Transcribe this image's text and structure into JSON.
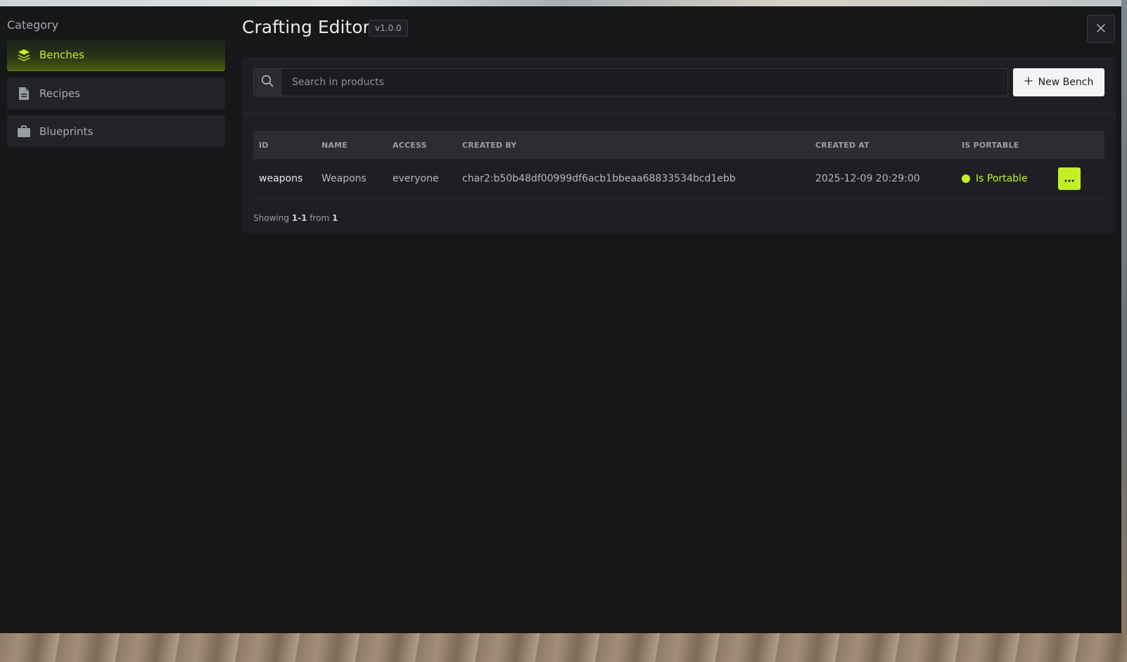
{
  "sidebar": {
    "heading": "Category",
    "items": [
      {
        "label": "Benches",
        "icon": "layers-icon",
        "active": true
      },
      {
        "label": "Recipes",
        "icon": "document-icon",
        "active": false
      },
      {
        "label": "Blueprints",
        "icon": "briefcase-icon",
        "active": false
      }
    ]
  },
  "header": {
    "title": "Crafting Editor",
    "version": "v1.0.0"
  },
  "toolbar": {
    "search_placeholder": "Search in products",
    "search_value": "",
    "new_button_label": "New Bench"
  },
  "table": {
    "columns": [
      "ID",
      "NAME",
      "ACCESS",
      "CREATED BY",
      "CREATED AT",
      "IS PORTABLE"
    ],
    "rows": [
      {
        "id": "weapons",
        "name": "Weapons",
        "access": "everyone",
        "created_by": "char2:b50b48df00999df6acb1bbeaa68833534bcd1ebb",
        "created_at": "2025-12-09 20:29:00",
        "is_portable": "Is Portable"
      }
    ]
  },
  "pagination": {
    "prefix": "Showing",
    "range": "1-1",
    "middle": "from",
    "total": "1"
  },
  "colors": {
    "accent": "#c3f024",
    "background": "#161719",
    "panel": "#1e1f22"
  }
}
